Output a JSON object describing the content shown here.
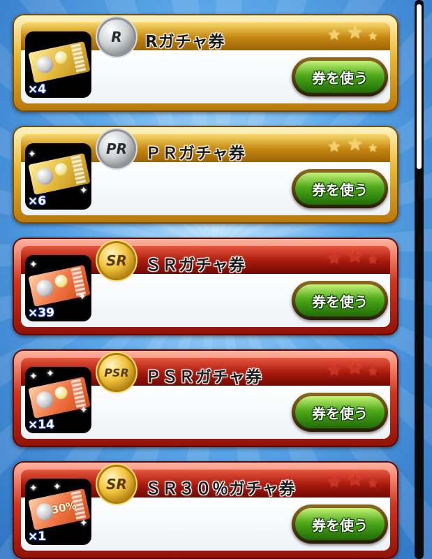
{
  "tickets": [
    {
      "title": "Rガチャ券",
      "badge": "R",
      "quantity": "×4",
      "use_label": "券を使う",
      "theme": "gold"
    },
    {
      "title": "ＰＲガチャ券",
      "badge": "PR",
      "quantity": "×6",
      "use_label": "券を使う",
      "theme": "gold"
    },
    {
      "title": "ＳＲガチャ券",
      "badge": "SR",
      "quantity": "×39",
      "use_label": "券を使う",
      "theme": "red"
    },
    {
      "title": "ＰＳＲガチャ券",
      "badge": "PSR",
      "quantity": "×14",
      "use_label": "券を使う",
      "theme": "red"
    },
    {
      "title": "ＳＲ３０％ガチャ券",
      "badge": "SR",
      "quantity": "×1",
      "use_label": "券を使う",
      "theme": "red",
      "ticket_text": "30%"
    }
  ],
  "colors": {
    "gold_frame": "#e9b52b",
    "red_frame": "#d5331c",
    "button_green": "#4faa1a",
    "background_blue": "#5aa6e8"
  },
  "scroll": {
    "position_fraction": 0.0,
    "visible_fraction": 0.3
  }
}
